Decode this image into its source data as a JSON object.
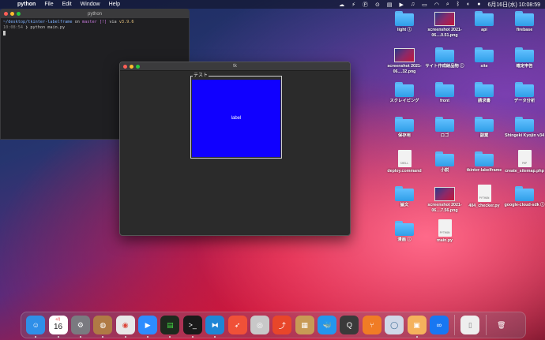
{
  "menubar": {
    "app_name": "python",
    "items": [
      "File",
      "Edit",
      "Window",
      "Help"
    ],
    "clock": "6月16日(水) 10:08:59"
  },
  "terminal": {
    "title": "python",
    "line1_path": "~/desktop/tkinter-labelframe",
    "line1_on": "on",
    "line1_branch": "master [!]",
    "line1_via": "via",
    "line1_version": "v3.9.6",
    "line2_time": "10:08:54",
    "line2_cmd": "❯ python main.py"
  },
  "tk_window": {
    "title": "tk",
    "labelframe_text": "テスト",
    "label_text": "label",
    "label_bg": "#1000ff"
  },
  "desktop": {
    "icons": [
      {
        "type": "folder",
        "label": "light ⓘ"
      },
      {
        "type": "thumb",
        "label": "screenshot 2021-06....0.51.png"
      },
      {
        "type": "folder",
        "label": "api"
      },
      {
        "type": "folder",
        "label": "firebase"
      },
      {
        "type": "thumb",
        "label": "screenshot 2021-06....32.png"
      },
      {
        "type": "folder",
        "label": "サイト作成納品物 ⓘ"
      },
      {
        "type": "folder",
        "label": "site"
      },
      {
        "type": "folder",
        "label": "確定申告"
      },
      {
        "type": "folder",
        "label": "スクレイピング"
      },
      {
        "type": "folder",
        "label": "front"
      },
      {
        "type": "folder",
        "label": "請求書"
      },
      {
        "type": "folder",
        "label": "データ分析"
      },
      {
        "type": "folder",
        "label": "保存用"
      },
      {
        "type": "folder",
        "label": "ロゴ"
      },
      {
        "type": "folder",
        "label": "副業"
      },
      {
        "type": "folder",
        "label": "Shingeki Kyojin v34"
      },
      {
        "type": "doc",
        "label": "deploy.command",
        "badge": "SHELL"
      },
      {
        "type": "folder",
        "label": "小説"
      },
      {
        "type": "folder",
        "label": "tkinter-labelframe"
      },
      {
        "type": "doc",
        "label": "create_sitemap.php",
        "badge": "PHP"
      },
      {
        "type": "folder",
        "label": "論文"
      },
      {
        "type": "thumb",
        "label": "screenshot 2021-06....7.56.png"
      },
      {
        "type": "doc",
        "label": "404_checker.py",
        "badge": "PYTHON"
      },
      {
        "type": "folder",
        "label": "google-cloud-sdk ⓘ"
      },
      {
        "type": "folder",
        "label": "漫画 ⓘ"
      },
      {
        "type": "doc",
        "label": "main.py",
        "badge": "PYTHON"
      }
    ]
  },
  "dock": {
    "calendar_month": "6月",
    "calendar_day": "16",
    "apps": [
      {
        "name": "finder",
        "color": "#2f8fe8",
        "glyph": "☺"
      },
      {
        "name": "calendar",
        "color": "#ffffff",
        "glyph": ""
      },
      {
        "name": "system-preferences",
        "color": "#7a7a80",
        "glyph": "⚙"
      },
      {
        "name": "contacts",
        "color": "#b07a45",
        "glyph": "◍"
      },
      {
        "name": "chrome",
        "color": "#e8e8e8",
        "glyph": "◉"
      },
      {
        "name": "zoom",
        "color": "#2d8cff",
        "glyph": "▶"
      },
      {
        "name": "activity-monitor",
        "color": "#1e2a1e",
        "glyph": "▤"
      },
      {
        "name": "terminal",
        "color": "#1a1a1a",
        "glyph": ">_"
      },
      {
        "name": "vscode",
        "color": "#1f86d6",
        "glyph": "⧓"
      },
      {
        "name": "swift",
        "color": "#f05138",
        "glyph": "➶"
      },
      {
        "name": "sequel",
        "color": "#c8c8c8",
        "glyph": "◎"
      },
      {
        "name": "stats",
        "color": "#e8462a",
        "glyph": "⤴"
      },
      {
        "name": "archive",
        "color": "#c89a55",
        "glyph": "▦"
      },
      {
        "name": "docker",
        "color": "#2496ed",
        "glyph": "🐳"
      },
      {
        "name": "quicktime",
        "color": "#3a3a3a",
        "glyph": "Q"
      },
      {
        "name": "sourcetree",
        "color": "#f07c25",
        "glyph": "⑂"
      },
      {
        "name": "postgres",
        "color": "#d0d8e8",
        "glyph": "◯"
      },
      {
        "name": "preview",
        "color": "#f5b25c",
        "glyph": "▣"
      },
      {
        "name": "infinity",
        "color": "#1877f2",
        "glyph": "∞"
      }
    ],
    "doc_glyph": "▯",
    "trash_glyph": "🗑"
  }
}
